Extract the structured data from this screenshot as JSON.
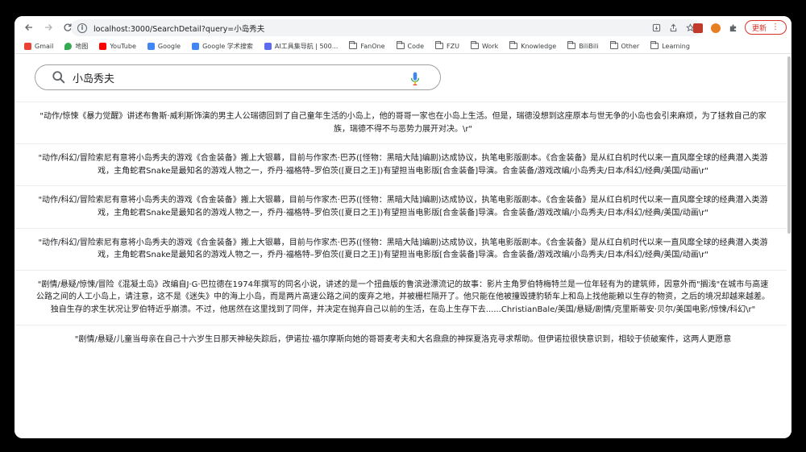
{
  "browser": {
    "url": "localhost:3000/SearchDetail?query=小岛秀夫",
    "update_label": "更新"
  },
  "bookmarks": [
    {
      "label": "Gmail",
      "icon": "gmail-icon",
      "color": "#ea4335"
    },
    {
      "label": "地图",
      "icon": "maps-icon",
      "color": "#34a853"
    },
    {
      "label": "YouTube",
      "icon": "youtube-icon",
      "color": "#ff0000"
    },
    {
      "label": "Google",
      "icon": "google-icon",
      "color": "#4285f4"
    },
    {
      "label": "Google 学术搜索",
      "icon": "scholar-icon",
      "color": "#4285f4"
    },
    {
      "label": "AI工具集导航 | 500...",
      "icon": "ai-tools-icon",
      "color": "#5b6cf0"
    },
    {
      "label": "FanOne",
      "icon": "folder-icon"
    },
    {
      "label": "Code",
      "icon": "folder-icon"
    },
    {
      "label": "FZU",
      "icon": "folder-icon"
    },
    {
      "label": "Work",
      "icon": "folder-icon"
    },
    {
      "label": "Knowledge",
      "icon": "folder-icon"
    },
    {
      "label": "BiliBili",
      "icon": "folder-icon"
    },
    {
      "label": "Other",
      "icon": "folder-icon"
    },
    {
      "label": "Learning",
      "icon": "folder-icon"
    }
  ],
  "search": {
    "value": "小岛秀夫"
  },
  "results": [
    {
      "text": "\"动作/惊悚《暴力觉醒》讲述布鲁斯·威利斯饰演的男主人公瑞德回到了自己童年生活的小岛上，他的哥哥一家也在小岛上生活。但是，瑞德没想到这座原本与世无争的小岛也会引来麻烦，为了拯救自己的家族，瑞德不得不与恶势力展开对决。\\r\""
    },
    {
      "text": "\"动作/科幻/冒险索尼有意将小岛秀夫的游戏《合金装备》搬上大银幕，目前与作家杰·巴苏([怪物：黑暗大陆]编剧)达成协议，执笔电影版剧本。《合金装备》是从红白机时代以来一直风靡全球的经典潜入类游戏，主角蛇君Snake是最知名的游戏人物之一，乔丹·福格特–罗伯茨([夏日之王])有望担当电影版[合金装备]导演。合金装备/游戏改编/小岛秀夫/日本/科幻/经典/美国/动画\\r\""
    },
    {
      "text": "\"动作/科幻/冒险索尼有意将小岛秀夫的游戏《合金装备》搬上大银幕，目前与作家杰·巴苏([怪物：黑暗大陆]编剧)达成协议，执笔电影版剧本。《合金装备》是从红白机时代以来一直风靡全球的经典潜入类游戏，主角蛇君Snake是最知名的游戏人物之一，乔丹·福格特–罗伯茨([夏日之王])有望担当电影版[合金装备]导演。合金装备/游戏改编/小岛秀夫/日本/科幻/经典/美国/动画\\r\""
    },
    {
      "text": "\"动作/科幻/冒险索尼有意将小岛秀夫的游戏《合金装备》搬上大银幕，目前与作家杰·巴苏([怪物：黑暗大陆]编剧)达成协议，执笔电影版剧本。《合金装备》是从红白机时代以来一直风靡全球的经典潜入类游戏，主角蛇君Snake是最知名的游戏人物之一，乔丹·福格特–罗伯茨([夏日之王])有望担当电影版[合金装备]导演。合金装备/游戏改编/小岛秀夫/日本/科幻/经典/美国/动画\\r\""
    },
    {
      "text": "\"剧情/悬疑/惊悚/冒险《混凝土岛》改编自J·G·巴拉德在1974年撰写的同名小说，讲述的是一个扭曲版的鲁滨逊漂流记的故事：影片主角罗伯特梅特兰是一位年轻有为的建筑师，因意外而\"搁浅\"在城市与高速公路之间的人工小岛上，请注意，这不是《迷失》中的海上小岛，而是两片高速公路之间的废弃之地，并被栅栏隔开了。他只能在他被撞毁捷豹轿车上和岛上找他能赖以生存的物资，之后的境况却越来越差。独自生存的求生状况让罗伯特近乎崩溃。不过，他居然在这里找到了同伴，并决定在抛弃自己以前的生活，在岛上生存下去......ChristianBale/美国/悬疑/剧情/克里斯蒂安·贝尔/美国电影/惊悚/科幻\\r\""
    },
    {
      "text": "\"剧情/悬疑/儿童当母亲在自己十六岁生日那天神秘失踪后，伊诺拉·福尔摩斯向她的哥哥麦考夫和大名鼎鼎的神探夏洛克寻求帮助。但伊诺拉很快意识到，相较于侦破案件，这两人更愿意"
    }
  ]
}
